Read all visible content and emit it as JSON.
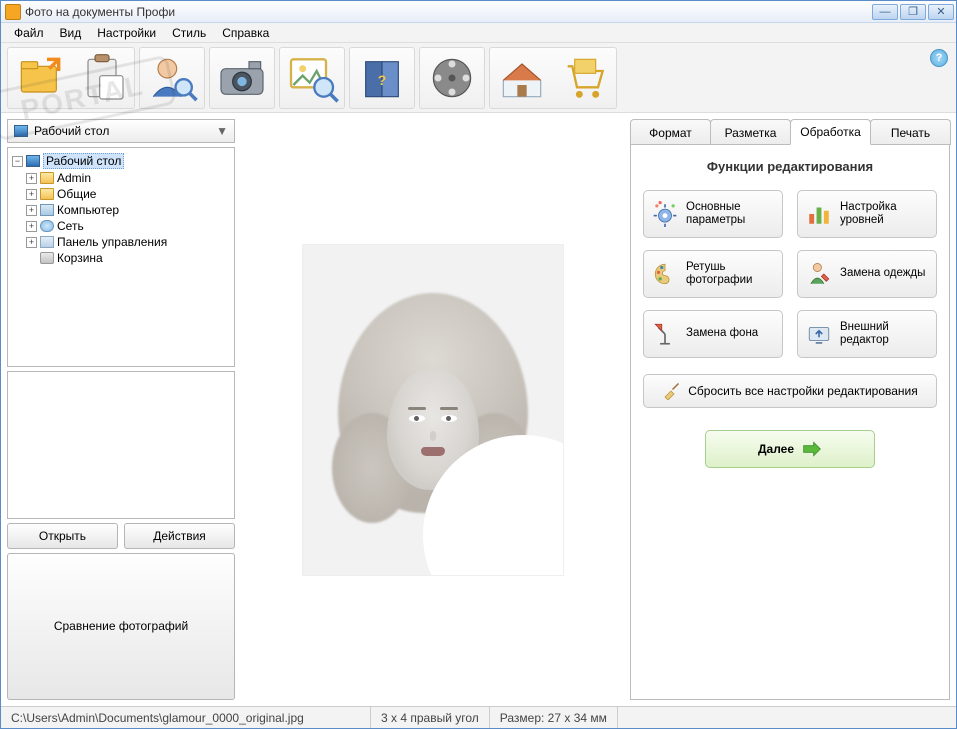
{
  "window": {
    "title": "Фото на документы Профи"
  },
  "menu": {
    "items": [
      "Файл",
      "Вид",
      "Настройки",
      "Стиль",
      "Справка"
    ]
  },
  "toolbar": {
    "icons": [
      "folder-export-icon",
      "clipboard-paste-icon",
      "user-search-icon",
      "camera-icon",
      "image-zoom-icon",
      "help-book-icon",
      "film-reel-icon",
      "home-icon",
      "shopping-cart-icon"
    ]
  },
  "combo": {
    "label": "Рабочий стол"
  },
  "tree": {
    "root": {
      "label": "Рабочий стол",
      "selected": true
    },
    "children": [
      {
        "icon": "fld",
        "label": "Admin"
      },
      {
        "icon": "fld",
        "label": "Общие"
      },
      {
        "icon": "pc",
        "label": "Компьютер"
      },
      {
        "icon": "net",
        "label": "Сеть"
      },
      {
        "icon": "cp",
        "label": "Панель управления"
      },
      {
        "icon": "bin",
        "label": "Корзина"
      }
    ]
  },
  "left_buttons": {
    "open": "Открыть",
    "actions": "Действия",
    "compare": "Сравнение фотографий"
  },
  "tabs": {
    "items": [
      "Формат",
      "Разметка",
      "Обработка",
      "Печать"
    ],
    "active": 2
  },
  "edit": {
    "title": "Функции редактирования",
    "buttons": [
      {
        "label": "Основные параметры",
        "icon": "gear-sparkle-icon"
      },
      {
        "label": "Настройка уровней",
        "icon": "bars-levels-icon"
      },
      {
        "label": "Ретушь фотографии",
        "icon": "palette-icon"
      },
      {
        "label": "Замена одежды",
        "icon": "person-shirt-icon"
      },
      {
        "label": "Замена фона",
        "icon": "lamp-icon"
      },
      {
        "label": "Внешний редактор",
        "icon": "monitor-upload-icon"
      }
    ],
    "reset": "Сбросить все настройки редактирования",
    "next": "Далее"
  },
  "status": {
    "path": "C:\\Users\\Admin\\Documents\\glamour_0000_original.jpg",
    "corner": "3 x 4 правый угол",
    "size": "Размер: 27 x 34 мм"
  },
  "watermark": "PORTAL"
}
